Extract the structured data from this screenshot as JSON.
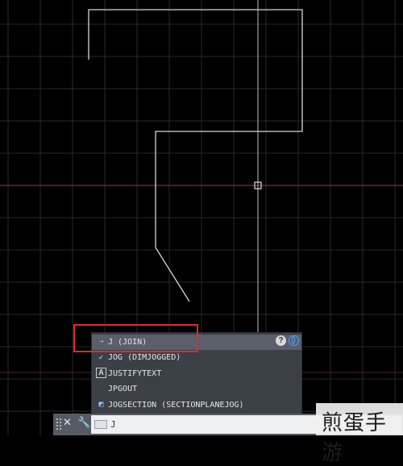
{
  "autocomplete": {
    "items": [
      {
        "label": "J (JOIN)",
        "icon": "join-icon",
        "selected": true
      },
      {
        "label": "JOG (DIMJOGGED)",
        "icon": "dimjogged-icon",
        "selected": false
      },
      {
        "label": "JUSTIFYTEXT",
        "icon": "text-a-icon",
        "selected": false
      },
      {
        "label": "JPGOUT",
        "icon": "",
        "selected": false
      },
      {
        "label": "JOGSECTION (SECTIONPLANEJOG)",
        "icon": "section-plane-icon",
        "selected": false
      }
    ],
    "help_label": "?"
  },
  "command_line": {
    "input_value": "J"
  },
  "watermark": {
    "text": "煎蛋手游"
  },
  "colors": {
    "background": "#000000",
    "grid": "#2a2a2a",
    "axis_red": "#8a2a2a",
    "geometry": "#d8d8d8",
    "highlight": "#e52929",
    "panel": "#3b3f46"
  }
}
